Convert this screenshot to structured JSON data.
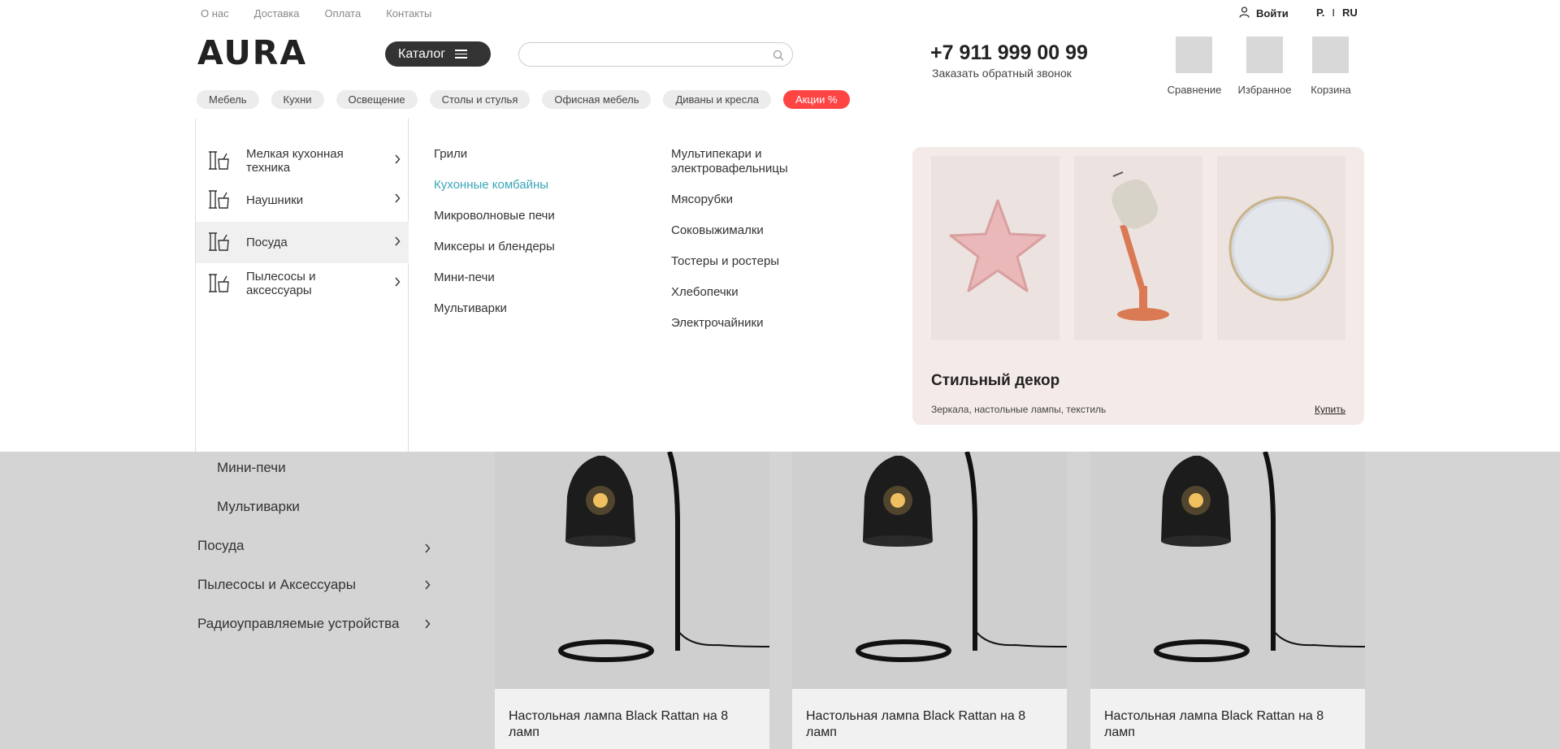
{
  "topbar": {
    "links": [
      "О нас",
      "Доставка",
      "Оплата",
      "Контакты"
    ],
    "login": "Войти",
    "currency": "Р.",
    "separator": "I",
    "language": "RU"
  },
  "header": {
    "logo": "AURA",
    "catalog": "Каталог",
    "search_placeholder": "",
    "phone": "+7 911 999 00 99",
    "callback": "Заказать обратный звонок",
    "actions": [
      "Сравнение",
      "Избранное",
      "Корзина"
    ]
  },
  "pills": [
    "Мебель",
    "Кухни",
    "Освещение",
    "Столы и стулья",
    "Офисная мебель",
    "Диваны и кресла",
    "Акции %"
  ],
  "mega": {
    "categories": [
      "Мелкая кухонная техника",
      "Наушники",
      "Посуда",
      "Пылесосы и аксессуары"
    ],
    "active_category": "Посуда",
    "col1": [
      "Грили",
      "Кухонные комбайны",
      "Микроволновые печи",
      "Миксеры и блендеры",
      "Мини-печи",
      "Мультиварки"
    ],
    "col1_highlight": "Кухонные комбайны",
    "col2": [
      "Мультипекари и электровафельницы",
      "Мясорубки",
      "Соковыжималки",
      "Тостеры и ростеры",
      "Хлебопечки",
      "Электрочайники"
    ],
    "promo": {
      "title": "Стильный декор",
      "description": "Зеркала, настольные лампы, текстиль",
      "buy": "Купить"
    }
  },
  "background": {
    "subcategories": [
      "Мини-печи",
      "Мультиварки"
    ],
    "categories": [
      "Посуда",
      "Пылесосы и Аксессуары",
      "Радиоуправляемые устройства"
    ],
    "products": [
      "Настольная лампа Black Rattan на 8 ламп",
      "Настольная лампа Black Rattan на 8 ламп",
      "Настольная лампа Black Rattan на 8 ламп"
    ]
  },
  "colors": {
    "accent": "#3aa6b9",
    "sale": "#ff4444",
    "dark": "#333333",
    "promo_bg": "#f4ebe8"
  }
}
